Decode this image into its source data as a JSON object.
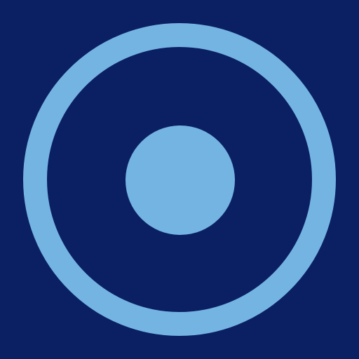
{
  "icon": {
    "name": "target-icon"
  },
  "colors": {
    "background": "#0B2062",
    "accent": "#74B4E3"
  }
}
